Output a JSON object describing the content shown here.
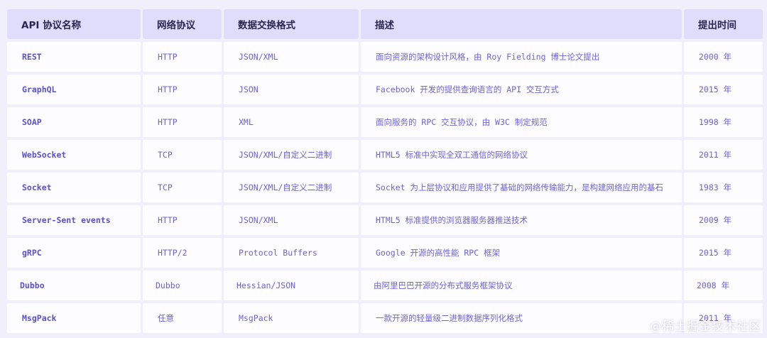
{
  "table": {
    "headers": [
      "API 协议名称",
      "网络协议",
      "数据交换格式",
      "描述",
      "提出时间"
    ],
    "rows": [
      [
        "REST",
        "HTTP",
        "JSON/XML",
        "面向资源的架构设计风格，由 Roy Fielding 博士论文提出",
        "2000 年"
      ],
      [
        "GraphQL",
        "HTTP",
        "JSON",
        "Facebook 开发的提供查询语言的 API 交互方式",
        "2015 年"
      ],
      [
        "SOAP",
        "HTTP",
        "XML",
        "面向服务的 RPC 交互协议，由 W3C 制定规范",
        "1998 年"
      ],
      [
        "WebSocket",
        "TCP",
        "JSON/XML/自定义二进制",
        "HTML5 标准中实现全双工通信的网络协议",
        "2011 年"
      ],
      [
        "Socket",
        "TCP",
        "JSON/XML/自定义二进制",
        "Socket 为上层协议和应用提供了基础的网络传输能力，是构建网络应用的基石",
        "1983 年"
      ],
      [
        "Server-Sent events",
        "HTTP",
        "JSON/XML",
        "HTML5 标准提供的浏览器服务器推送技术",
        "2009 年"
      ],
      [
        "gRPC",
        "HTTP/2",
        "Protocol Buffers",
        "Google 开源的高性能 RPC 框架",
        "2015 年"
      ],
      [
        "Dubbo",
        "Dubbo",
        "Hessian/JSON",
        "由阿里巴巴开源的分布式服务框架协议",
        "2008 年"
      ],
      [
        "MsgPack",
        "任意",
        "MsgPack",
        "一款开源的轻量级二进制数据序列化格式",
        "2011 年"
      ]
    ]
  },
  "watermark": {
    "at": "@",
    "text": "稀土掘金技术社区"
  }
}
